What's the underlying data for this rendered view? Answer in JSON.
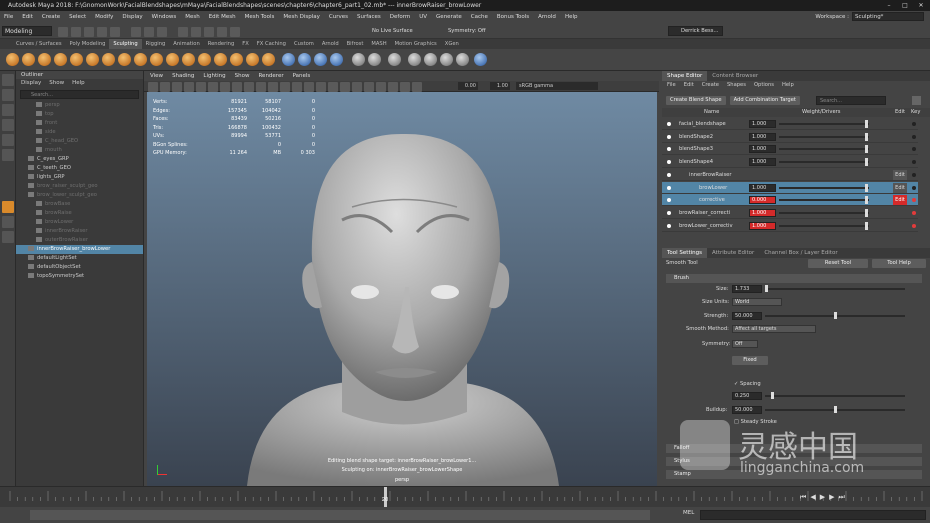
{
  "window": {
    "title": "Autodesk Maya 2018: F:\\GnomonWork\\FacialBlendshapes\\mMaya\\FacialBlendshapes\\scenes\\chapter6\\chapter6_part1_02.mb* --- innerBrowRaiser_browLower",
    "controls": [
      "–",
      "□",
      "✕"
    ]
  },
  "menubar": {
    "items": [
      "File",
      "Edit",
      "Create",
      "Select",
      "Modify",
      "Display",
      "Windows",
      "Mesh",
      "Edit Mesh",
      "Mesh Tools",
      "Mesh Display",
      "Curves",
      "Surfaces",
      "Deform",
      "UV",
      "Generate",
      "Cache",
      "Bonus Tools",
      "Arnold",
      "Help"
    ],
    "workspace_label": "Workspace :",
    "workspace_value": "Sculpting*"
  },
  "statusline": {
    "mode": "Modeling",
    "no_live": "No Live Surface",
    "symmetry": "Symmetry: Off",
    "user": "Derrick Bess..."
  },
  "shelf": {
    "tabs": [
      "Curves / Surfaces",
      "Poly Modeling",
      "Sculpting",
      "Rigging",
      "Animation",
      "Rendering",
      "FX",
      "FX Caching",
      "Custom",
      "Arnold",
      "Bifrost",
      "MASH",
      "Motion Graphics",
      "XGen"
    ],
    "active_tab": "Sculpting"
  },
  "outliner": {
    "title": "Outliner",
    "menu": [
      "Display",
      "Show",
      "Help"
    ],
    "search_placeholder": "Search...",
    "items": [
      {
        "label": "persp",
        "dim": true,
        "indent": 2
      },
      {
        "label": "top",
        "dim": true,
        "indent": 2
      },
      {
        "label": "front",
        "dim": true,
        "indent": 2
      },
      {
        "label": "side",
        "dim": true,
        "indent": 2
      },
      {
        "label": "C_head_GEO",
        "dim": true,
        "indent": 2
      },
      {
        "label": "mouth",
        "dim": true,
        "indent": 2
      },
      {
        "label": "C_eyes_GRP",
        "dim": false,
        "indent": 1
      },
      {
        "label": "C_teeth_GEO",
        "dim": false,
        "indent": 1
      },
      {
        "label": "lights_GRP",
        "dim": false,
        "indent": 1
      },
      {
        "label": "brow_raiser_sculpt_geo",
        "dim": true,
        "indent": 1
      },
      {
        "label": "brow_lower_sculpt_geo",
        "dim": true,
        "indent": 1
      },
      {
        "label": "browBase",
        "dim": true,
        "indent": 2
      },
      {
        "label": "browRaise",
        "dim": true,
        "indent": 2
      },
      {
        "label": "browLower",
        "dim": true,
        "indent": 2
      },
      {
        "label": "innerBrowRaiser",
        "dim": true,
        "indent": 2
      },
      {
        "label": "outerBrowRaiser",
        "dim": true,
        "indent": 2
      },
      {
        "label": "innerBrowRaiser_browLower",
        "dim": false,
        "selected": true,
        "indent": 1
      },
      {
        "label": "defaultLightSet",
        "dim": false,
        "indent": 1
      },
      {
        "label": "defaultObjectSet",
        "dim": false,
        "indent": 1
      },
      {
        "label": "topoSymmetrySet",
        "dim": false,
        "indent": 1
      }
    ]
  },
  "viewport": {
    "menu": [
      "View",
      "Shading",
      "Lighting",
      "Show",
      "Renderer",
      "Panels"
    ],
    "toolbar_values": [
      "0.00",
      "1.00"
    ],
    "colorspace": "sRGB gamma",
    "hud": [
      {
        "k": "Verts:",
        "a": "81921",
        "b": "58107",
        "c": "0"
      },
      {
        "k": "Edges:",
        "a": "157345",
        "b": "104042",
        "c": "0"
      },
      {
        "k": "Faces:",
        "a": "83439",
        "b": "50216",
        "c": "0"
      },
      {
        "k": "Tris:",
        "a": "166878",
        "b": "100432",
        "c": "0"
      },
      {
        "k": "UVs:",
        "a": "89994",
        "b": "53771",
        "c": "0"
      },
      {
        "k": "BGon Splines:",
        "a": "",
        "b": "0",
        "c": "0"
      },
      {
        "k": "GPU Memory:",
        "a": "11 264",
        "b": "MB",
        "c": "0 303"
      }
    ],
    "message_line1": "Editing blend shape target: innerBrowRaiser_browLower1...",
    "message_line2": "Sculpting on: innerBrowRaiser_browLowerShape",
    "camera": "persp"
  },
  "shape_editor": {
    "tabs": [
      "Shape Editor",
      "Content Browser"
    ],
    "menu": [
      "File",
      "Edit",
      "Create",
      "Shapes",
      "Options",
      "Help"
    ],
    "create_blend_shape": "Create Blend Shape",
    "add_combination_target": "Add Combination Target",
    "search_placeholder": "Search...",
    "columns": {
      "name": "Name",
      "weight": "Weight/Drivers",
      "edit": "Edit",
      "key": "Key"
    },
    "rows": [
      {
        "name": "facial_blendshape",
        "weight": "1.000",
        "indent": 0,
        "selected": false,
        "red": false,
        "keyred": false,
        "edit": ""
      },
      {
        "name": "blendShape2",
        "weight": "1.000",
        "indent": 0,
        "selected": false,
        "red": false,
        "keyred": false,
        "edit": ""
      },
      {
        "name": "blendShape3",
        "weight": "1.000",
        "indent": 0,
        "selected": false,
        "red": false,
        "keyred": false,
        "edit": ""
      },
      {
        "name": "blendShape4",
        "weight": "1.000",
        "indent": 0,
        "selected": false,
        "red": false,
        "keyred": false,
        "edit": ""
      },
      {
        "name": "innerBrowRaiser",
        "weight": "",
        "indent": 1,
        "selected": false,
        "red": false,
        "keyred": false,
        "edit": "Edit"
      },
      {
        "name": "browLower",
        "weight": "1.000",
        "indent": 2,
        "selected": true,
        "red": false,
        "keyred": false,
        "edit": "Edit"
      },
      {
        "name": "corrective",
        "weight": "0.000",
        "indent": 2,
        "selected": true,
        "red": true,
        "keyred": true,
        "edit": "Edit"
      },
      {
        "name": "browRaiser_correcti",
        "weight": "1.000",
        "indent": 0,
        "selected": false,
        "red": true,
        "keyred": true,
        "edit": ""
      },
      {
        "name": "browLower_correctiv",
        "weight": "1.000",
        "indent": 0,
        "selected": false,
        "red": true,
        "keyred": true,
        "edit": ""
      }
    ]
  },
  "tool_settings": {
    "tabs": [
      "Tool Settings",
      "Attribute Editor",
      "Channel Box / Layer Editor"
    ],
    "tool_name": "Smooth Tool",
    "reset": "Reset Tool",
    "help": "Tool Help",
    "brush_section": "Brush",
    "size_label": "Size:",
    "size_value": "1.733",
    "size_units_label": "Size Units:",
    "size_units_value": "World",
    "strength_label": "Strength:",
    "strength_value": "50.000",
    "smooth_method_label": "Smooth Method:",
    "smooth_method_value": "Affect all targets",
    "symmetry_label": "Symmetry:",
    "symmetry_value": "Off",
    "fixed": "Fixed",
    "spacing_label": "Spacing",
    "spacing_value": "0.250",
    "buildup_label": "Buildup:",
    "buildup_value": "50.000",
    "steady_stroke": "Steady Stroke",
    "sections": [
      "Falloff",
      "Stylus",
      "Stamp"
    ]
  },
  "timeline": {
    "current_frame": "20",
    "mel": "MEL"
  },
  "watermark": {
    "cn": "灵感中国",
    "url": "lingganchina.com"
  }
}
